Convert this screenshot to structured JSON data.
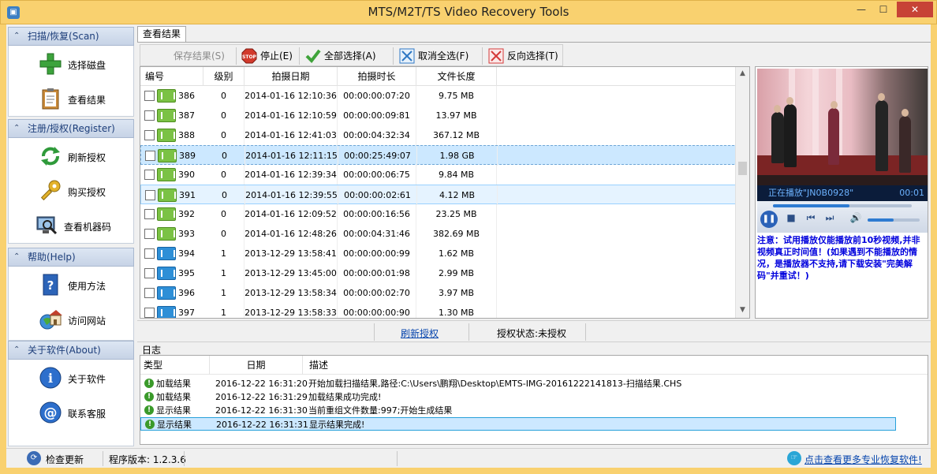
{
  "window": {
    "title": "MTS/M2T/TS Video Recovery Tools",
    "minimize": "—",
    "maximize": "☐",
    "close": "✕"
  },
  "sidebar": {
    "sections": [
      {
        "title": "扫描/恢复(Scan)",
        "items": [
          {
            "label": "选择磁盘",
            "icon": "green-plus-icon"
          },
          {
            "label": "查看结果",
            "icon": "clipboard-icon"
          }
        ]
      },
      {
        "title": "注册/授权(Register)",
        "items": [
          {
            "label": "刷新授权",
            "icon": "refresh-icon"
          },
          {
            "label": "购买授权",
            "icon": "key-icon"
          },
          {
            "label": "查看机器码",
            "icon": "computer-search-icon"
          }
        ]
      },
      {
        "title": "帮助(Help)",
        "items": [
          {
            "label": "使用方法",
            "icon": "help-book-icon"
          },
          {
            "label": "访问网站",
            "icon": "home-globe-icon"
          }
        ]
      },
      {
        "title": "关于软件(About)",
        "items": [
          {
            "label": "关于软件",
            "icon": "info-icon"
          },
          {
            "label": "联系客服",
            "icon": "at-icon"
          }
        ]
      }
    ]
  },
  "tabs": [
    "查看结果"
  ],
  "toolbar": {
    "save": "保存结果(S)",
    "stop": "停止(E)",
    "select_all": "全部选择(A)",
    "deselect_all": "取消全选(F)",
    "invert": "反向选择(T)"
  },
  "grid": {
    "columns": [
      "编号",
      "级别",
      "拍摄日期",
      "拍摄时长",
      "文件长度"
    ],
    "rows": [
      {
        "id": "386",
        "level": "0",
        "date": "2014-01-16 12:10:36",
        "duration": "00:00:00:07:20",
        "size": "9.75 MB",
        "type": "green"
      },
      {
        "id": "387",
        "level": "0",
        "date": "2014-01-16 12:10:59",
        "duration": "00:00:00:09:81",
        "size": "13.97 MB",
        "type": "green"
      },
      {
        "id": "388",
        "level": "0",
        "date": "2014-01-16 12:41:03",
        "duration": "00:00:04:32:34",
        "size": "367.12 MB",
        "type": "green"
      },
      {
        "id": "389",
        "level": "0",
        "date": "2014-01-16 12:11:15",
        "duration": "00:00:25:49:07",
        "size": "1.98 GB",
        "type": "green"
      },
      {
        "id": "390",
        "level": "0",
        "date": "2014-01-16 12:39:34",
        "duration": "00:00:00:06:75",
        "size": "9.84 MB",
        "type": "green"
      },
      {
        "id": "391",
        "level": "0",
        "date": "2014-01-16 12:39:55",
        "duration": "00:00:00:02:61",
        "size": "4.12 MB",
        "type": "green"
      },
      {
        "id": "392",
        "level": "0",
        "date": "2014-01-16 12:09:52",
        "duration": "00:00:00:16:56",
        "size": "23.25 MB",
        "type": "green"
      },
      {
        "id": "393",
        "level": "0",
        "date": "2014-01-16 12:48:26",
        "duration": "00:00:04:31:46",
        "size": "382.69 MB",
        "type": "green"
      },
      {
        "id": "394",
        "level": "1",
        "date": "2013-12-29 13:58:41",
        "duration": "00:00:00:00:99",
        "size": "1.62 MB",
        "type": "blue"
      },
      {
        "id": "395",
        "level": "1",
        "date": "2013-12-29 13:45:00",
        "duration": "00:00:00:01:98",
        "size": "2.99 MB",
        "type": "blue"
      },
      {
        "id": "396",
        "level": "1",
        "date": "2013-12-29 13:58:34",
        "duration": "00:00:00:02:70",
        "size": "3.97 MB",
        "type": "blue"
      },
      {
        "id": "397",
        "level": "1",
        "date": "2013-12-29 13:58:33",
        "duration": "00:00:00:00:90",
        "size": "1.30 MB",
        "type": "blue"
      }
    ]
  },
  "player": {
    "status": "正在播放\"JN0B0928\"",
    "time": "00:01",
    "progress": 0.55,
    "volume": 0.5,
    "note": "注意：试用播放仅能播放前10秒视频,并非视频真正时间值！(如果遇到不能播放的情况，是播放器不支持,请下载安装\"完美解码\"并重试！)"
  },
  "midbar": {
    "refresh_link": "刷新授权",
    "auth_status": "授权状态:未授权"
  },
  "log": {
    "label": "日志",
    "columns": [
      "类型",
      "日期",
      "描述"
    ],
    "rows": [
      {
        "type": "加载结果",
        "date": "2016-12-22 16:31:20",
        "desc": "开始加载扫描结果,路径:C:\\Users\\鹏翔\\Desktop\\EMTS-IMG-20161222141813-扫描结果.CHS"
      },
      {
        "type": "加载结果",
        "date": "2016-12-22 16:31:29",
        "desc": "加载结果成功完成!"
      },
      {
        "type": "显示结果",
        "date": "2016-12-22 16:31:30",
        "desc": "当前重组文件数量:997;开始生成结果"
      },
      {
        "type": "显示结果",
        "date": "2016-12-22 16:31:31",
        "desc": "显示结果完成!"
      }
    ]
  },
  "statusbar": {
    "check_update": "检查更新",
    "version": "程序版本: 1.2.3.6",
    "promo": "点击查看更多专业恢复软件!"
  },
  "colors": {
    "frame": "#f9d16f",
    "selection": "#cce8ff",
    "link": "#0645ad",
    "note": "#0000dd"
  }
}
